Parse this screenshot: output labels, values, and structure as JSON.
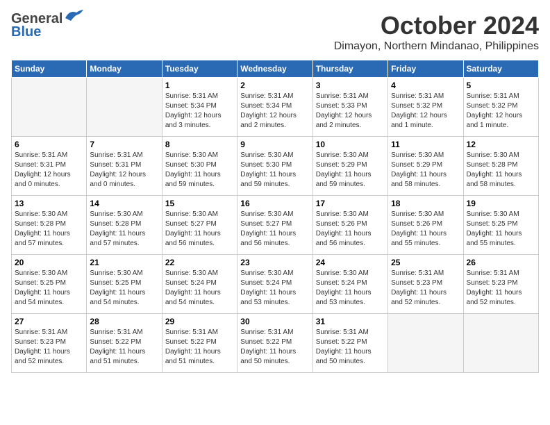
{
  "logo": {
    "general": "General",
    "blue": "Blue"
  },
  "title": "October 2024",
  "location": "Dimayon, Northern Mindanao, Philippines",
  "days_header": [
    "Sunday",
    "Monday",
    "Tuesday",
    "Wednesday",
    "Thursday",
    "Friday",
    "Saturday"
  ],
  "weeks": [
    [
      {
        "day": "",
        "info": ""
      },
      {
        "day": "",
        "info": ""
      },
      {
        "day": "1",
        "info": "Sunrise: 5:31 AM\nSunset: 5:34 PM\nDaylight: 12 hours\nand 3 minutes."
      },
      {
        "day": "2",
        "info": "Sunrise: 5:31 AM\nSunset: 5:34 PM\nDaylight: 12 hours\nand 2 minutes."
      },
      {
        "day": "3",
        "info": "Sunrise: 5:31 AM\nSunset: 5:33 PM\nDaylight: 12 hours\nand 2 minutes."
      },
      {
        "day": "4",
        "info": "Sunrise: 5:31 AM\nSunset: 5:32 PM\nDaylight: 12 hours\nand 1 minute."
      },
      {
        "day": "5",
        "info": "Sunrise: 5:31 AM\nSunset: 5:32 PM\nDaylight: 12 hours\nand 1 minute."
      }
    ],
    [
      {
        "day": "6",
        "info": "Sunrise: 5:31 AM\nSunset: 5:31 PM\nDaylight: 12 hours\nand 0 minutes."
      },
      {
        "day": "7",
        "info": "Sunrise: 5:31 AM\nSunset: 5:31 PM\nDaylight: 12 hours\nand 0 minutes."
      },
      {
        "day": "8",
        "info": "Sunrise: 5:30 AM\nSunset: 5:30 PM\nDaylight: 11 hours\nand 59 minutes."
      },
      {
        "day": "9",
        "info": "Sunrise: 5:30 AM\nSunset: 5:30 PM\nDaylight: 11 hours\nand 59 minutes."
      },
      {
        "day": "10",
        "info": "Sunrise: 5:30 AM\nSunset: 5:29 PM\nDaylight: 11 hours\nand 59 minutes."
      },
      {
        "day": "11",
        "info": "Sunrise: 5:30 AM\nSunset: 5:29 PM\nDaylight: 11 hours\nand 58 minutes."
      },
      {
        "day": "12",
        "info": "Sunrise: 5:30 AM\nSunset: 5:28 PM\nDaylight: 11 hours\nand 58 minutes."
      }
    ],
    [
      {
        "day": "13",
        "info": "Sunrise: 5:30 AM\nSunset: 5:28 PM\nDaylight: 11 hours\nand 57 minutes."
      },
      {
        "day": "14",
        "info": "Sunrise: 5:30 AM\nSunset: 5:28 PM\nDaylight: 11 hours\nand 57 minutes."
      },
      {
        "day": "15",
        "info": "Sunrise: 5:30 AM\nSunset: 5:27 PM\nDaylight: 11 hours\nand 56 minutes."
      },
      {
        "day": "16",
        "info": "Sunrise: 5:30 AM\nSunset: 5:27 PM\nDaylight: 11 hours\nand 56 minutes."
      },
      {
        "day": "17",
        "info": "Sunrise: 5:30 AM\nSunset: 5:26 PM\nDaylight: 11 hours\nand 56 minutes."
      },
      {
        "day": "18",
        "info": "Sunrise: 5:30 AM\nSunset: 5:26 PM\nDaylight: 11 hours\nand 55 minutes."
      },
      {
        "day": "19",
        "info": "Sunrise: 5:30 AM\nSunset: 5:25 PM\nDaylight: 11 hours\nand 55 minutes."
      }
    ],
    [
      {
        "day": "20",
        "info": "Sunrise: 5:30 AM\nSunset: 5:25 PM\nDaylight: 11 hours\nand 54 minutes."
      },
      {
        "day": "21",
        "info": "Sunrise: 5:30 AM\nSunset: 5:25 PM\nDaylight: 11 hours\nand 54 minutes."
      },
      {
        "day": "22",
        "info": "Sunrise: 5:30 AM\nSunset: 5:24 PM\nDaylight: 11 hours\nand 54 minutes."
      },
      {
        "day": "23",
        "info": "Sunrise: 5:30 AM\nSunset: 5:24 PM\nDaylight: 11 hours\nand 53 minutes."
      },
      {
        "day": "24",
        "info": "Sunrise: 5:30 AM\nSunset: 5:24 PM\nDaylight: 11 hours\nand 53 minutes."
      },
      {
        "day": "25",
        "info": "Sunrise: 5:31 AM\nSunset: 5:23 PM\nDaylight: 11 hours\nand 52 minutes."
      },
      {
        "day": "26",
        "info": "Sunrise: 5:31 AM\nSunset: 5:23 PM\nDaylight: 11 hours\nand 52 minutes."
      }
    ],
    [
      {
        "day": "27",
        "info": "Sunrise: 5:31 AM\nSunset: 5:23 PM\nDaylight: 11 hours\nand 52 minutes."
      },
      {
        "day": "28",
        "info": "Sunrise: 5:31 AM\nSunset: 5:22 PM\nDaylight: 11 hours\nand 51 minutes."
      },
      {
        "day": "29",
        "info": "Sunrise: 5:31 AM\nSunset: 5:22 PM\nDaylight: 11 hours\nand 51 minutes."
      },
      {
        "day": "30",
        "info": "Sunrise: 5:31 AM\nSunset: 5:22 PM\nDaylight: 11 hours\nand 50 minutes."
      },
      {
        "day": "31",
        "info": "Sunrise: 5:31 AM\nSunset: 5:22 PM\nDaylight: 11 hours\nand 50 minutes."
      },
      {
        "day": "",
        "info": ""
      },
      {
        "day": "",
        "info": ""
      }
    ]
  ]
}
